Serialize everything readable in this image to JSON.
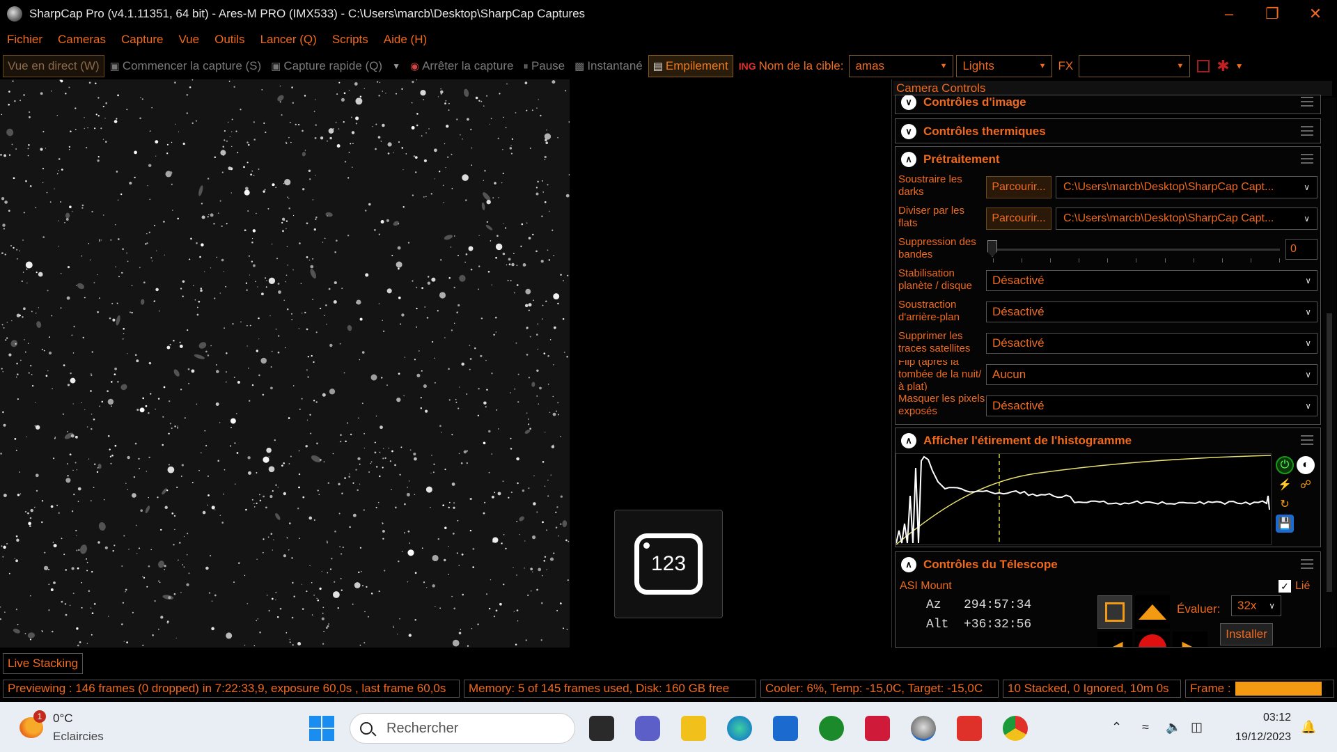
{
  "window": {
    "title": "SharpCap Pro (v4.1.11351, 64 bit) - Ares-M PRO (IMX533) - C:\\Users\\marcb\\Desktop\\SharpCap Captures"
  },
  "menu": [
    "Fichier",
    "Cameras",
    "Capture",
    "Vue",
    "Outils",
    "Lancer (Q)",
    "Scripts",
    "Aide (H)"
  ],
  "toolbar": {
    "live_view": "Vue en direct (W)",
    "start_capture": "Commencer la capture (S)",
    "quick_capture": "Capture rapide (Q)",
    "stop_capture": "Arrêter la capture",
    "pause": "Pause",
    "snapshot": "Instantané",
    "stacking": "Empilement",
    "target_label": "Nom de la cible:",
    "target_value": "amas",
    "frame_type": "Lights",
    "fx_label": "FX",
    "fx_value": ""
  },
  "panel": {
    "title": "Camera Controls",
    "sections": {
      "image_controls": "Contrôles d'image",
      "thermal": "Contrôles thermiques",
      "preprocessing": "Prétraitement",
      "histogram": "Afficher l'étirement de l'histogramme",
      "telescope": "Contrôles du Télescope"
    },
    "preproc": {
      "darks_label": "Soustraire les darks",
      "darks_browse": "Parcourir...",
      "darks_path": "C:\\Users\\marcb\\Desktop\\SharpCap Capt...",
      "flats_label": "Diviser par les flats",
      "flats_browse": "Parcourir...",
      "flats_path": "C:\\Users\\marcb\\Desktop\\SharpCap Capt...",
      "banding_label": "Suppression des bandes",
      "banding_value": "0",
      "stabilize_label": "Stabilisation planète / disque",
      "stabilize_value": "Désactivé",
      "bg_sub_label": "Soustraction d'arrière-plan",
      "bg_sub_value": "Désactivé",
      "satellite_label": "Supprimer les traces satellites",
      "satellite_value": "Désactivé",
      "flip_label": "Flip (après la tombée de la nuit/à plat)",
      "flip_value": "Aucun",
      "hot_pixels_label": "Masquer les pixels exposés",
      "hot_pixels_value": "Désactivé"
    },
    "telescope": {
      "mount": "ASI Mount",
      "linked_label": "Lié",
      "az": "Az   294:57:34",
      "alt": "Alt  +36:32:56",
      "rate_label": "Évaluer:",
      "rate_value": "32x",
      "install": "Installer"
    }
  },
  "status": {
    "tab": "Live Stacking",
    "preview": "Previewing : 146 frames (0 dropped) in 7:22:33,9, exposure 60,0s , last frame 60,0s",
    "memory": "Memory: 5 of 145 frames used, Disk: 160 GB free",
    "cooler": "Cooler: 6%, Temp: -15,0C, Target: -15,0C",
    "stacked": "10 Stacked, 0 Ignored, 10m 0s",
    "frame_label": "Frame :"
  },
  "taskbar": {
    "badge": "1",
    "temperature": "0°C",
    "weather": "Eclaircies",
    "search_placeholder": "Rechercher",
    "time": "03:12",
    "date": "19/12/2023"
  },
  "logo_text": "123",
  "colors": {
    "accent": "#f06a1e",
    "progress": "#f39a12",
    "histogram_curve": "#e8e070"
  }
}
